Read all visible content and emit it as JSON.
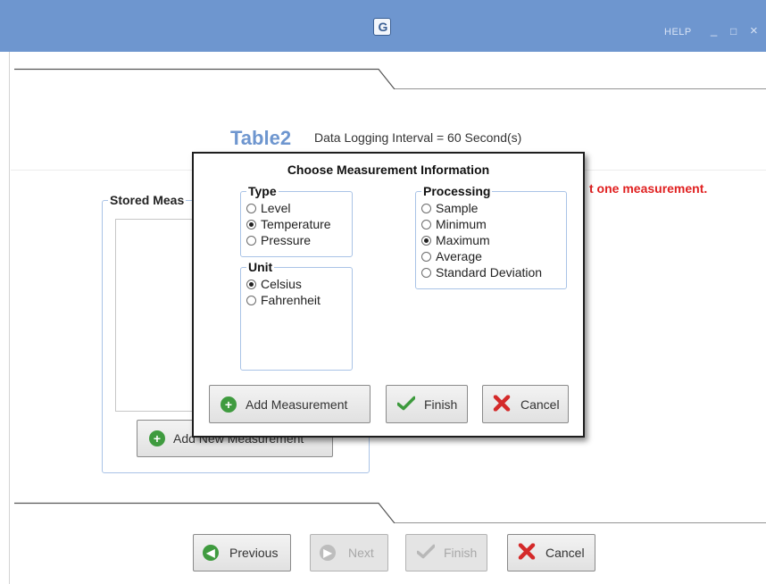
{
  "window": {
    "help_label": "HELP",
    "minimize_glyph": "_",
    "maximize_glyph": "□",
    "close_glyph": "×",
    "logo_glyph": "G",
    "accent_color": "#6e96cf"
  },
  "page": {
    "table_name": "Table2",
    "interval_text": "Data Logging Interval = 60 Second(s)",
    "warning_text": "t one measurement.",
    "stored_legend": "Stored Meas",
    "add_new_button": "Add New Measurement"
  },
  "dialog": {
    "title": "Choose Measurement Information",
    "type_group": {
      "legend": "Type",
      "options": [
        "Level",
        "Temperature",
        "Pressure"
      ],
      "selected": "Temperature"
    },
    "unit_group": {
      "legend": "Unit",
      "options": [
        "Celsius",
        "Fahrenheit"
      ],
      "selected": "Celsius"
    },
    "processing_group": {
      "legend": "Processing",
      "options": [
        "Sample",
        "Minimum",
        "Maximum",
        "Average",
        "Standard Deviation"
      ],
      "selected": "Maximum"
    },
    "buttons": {
      "add_measurement": "Add Measurement",
      "finish": "Finish",
      "cancel": "Cancel"
    }
  },
  "footer": {
    "previous": "Previous",
    "next": "Next",
    "finish": "Finish",
    "cancel": "Cancel"
  }
}
